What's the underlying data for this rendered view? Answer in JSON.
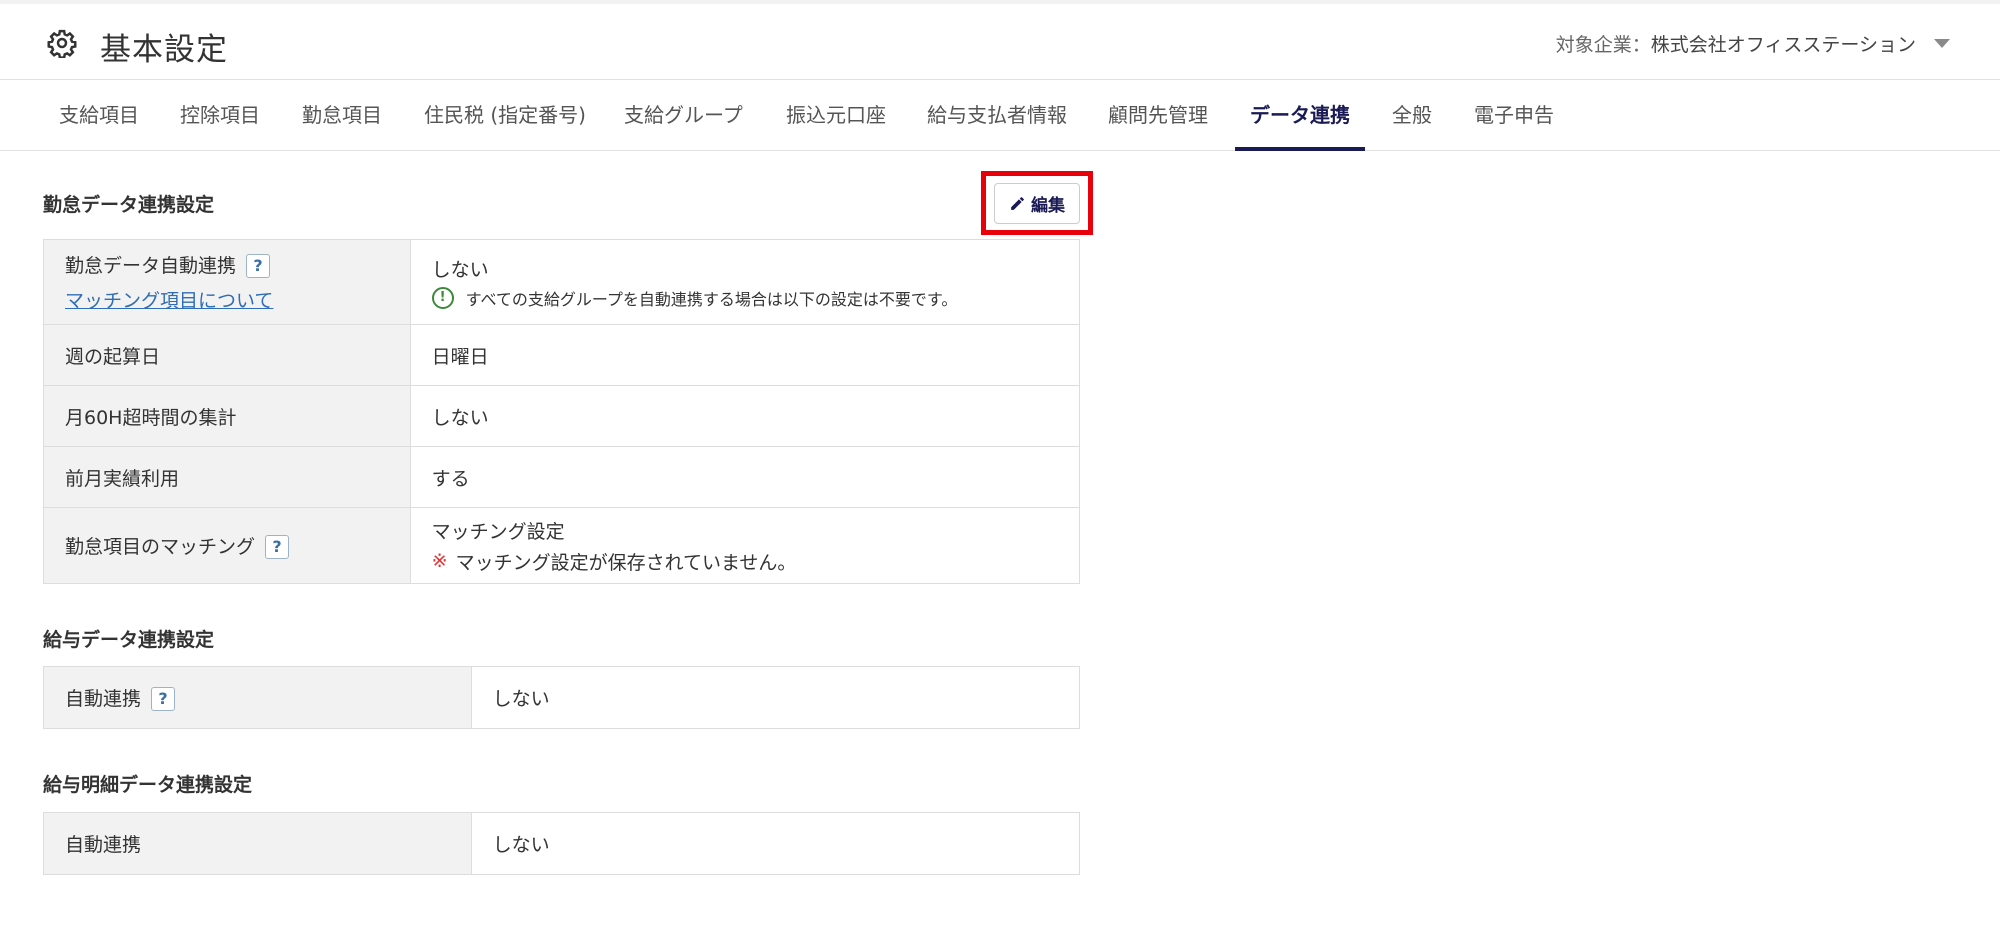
{
  "header": {
    "title": "基本設定",
    "company_label": "対象企業：",
    "company_name": "株式会社オフィスステーション"
  },
  "tabs": [
    {
      "label": "支給項目"
    },
    {
      "label": "控除項目"
    },
    {
      "label": "勤怠項目"
    },
    {
      "label": "住民税 (指定番号)"
    },
    {
      "label": "支給グループ"
    },
    {
      "label": "振込元口座"
    },
    {
      "label": "給与支払者情報"
    },
    {
      "label": "顧問先管理"
    },
    {
      "label": "データ連携",
      "active": true
    },
    {
      "label": "全般"
    },
    {
      "label": "電子申告"
    }
  ],
  "attendance": {
    "title": "勤怠データ連携設定",
    "edit_label": "編集",
    "rows": {
      "auto_link": {
        "label": "勤怠データ自動連携",
        "help": "?",
        "link": "マッチング項目について",
        "value": "しない",
        "note": "すべての支給グループを自動連携する場合は以下の設定は不要です。"
      },
      "week_start": {
        "label": "週の起算日",
        "value": "日曜日"
      },
      "overtime60": {
        "label": "月60H超時間の集計",
        "value": "しない"
      },
      "prev_month": {
        "label": "前月実績利用",
        "value": "する"
      },
      "matching": {
        "label": "勤怠項目のマッチング",
        "help": "?",
        "value": "マッチング設定",
        "warning_mark": "※",
        "warning": "マッチング設定が保存されていません。"
      }
    }
  },
  "salary": {
    "title": "給与データ連携設定",
    "rows": {
      "auto_link": {
        "label": "自動連携",
        "help": "?",
        "value": "しない"
      }
    }
  },
  "payslip": {
    "title": "給与明細データ連携設定",
    "rows": {
      "auto_link": {
        "label": "自動連携",
        "value": "しない"
      }
    }
  },
  "colors": {
    "accent": "#1a1a55",
    "highlight": "#e8000b",
    "link": "#2f6db5",
    "info": "#3a8a3a",
    "warning": "#e03030"
  },
  "icons": {
    "title": "gear-icon",
    "company": "caret-down-icon",
    "edit": "pencil-icon",
    "help": "help-icon",
    "note": "info-circle-icon"
  }
}
